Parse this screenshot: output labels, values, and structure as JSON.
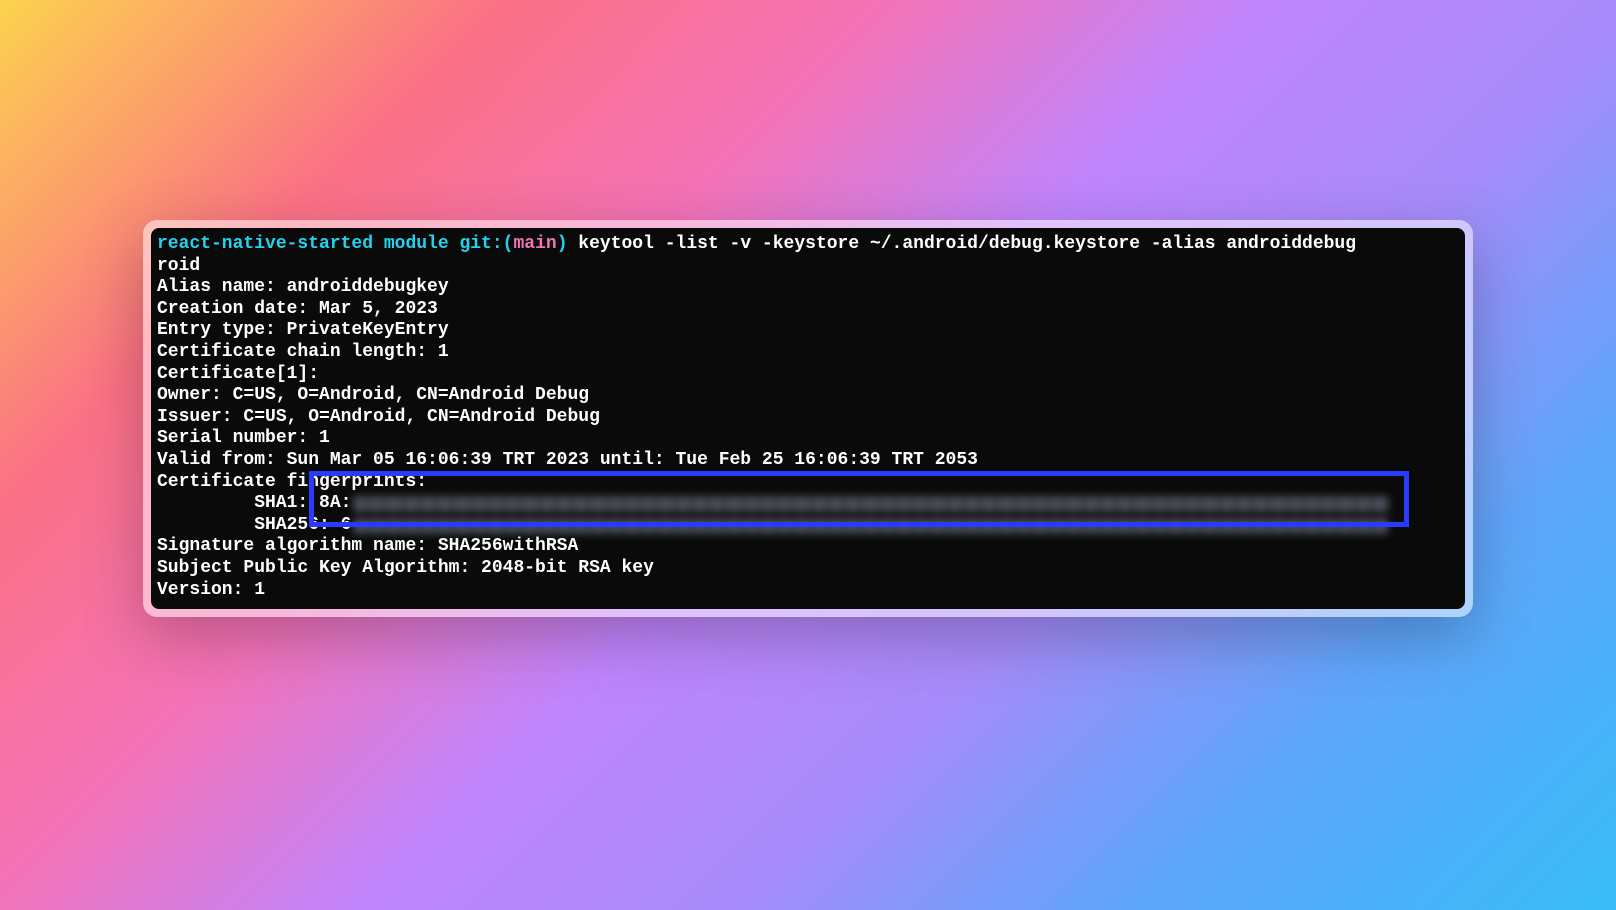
{
  "colors": {
    "highlight_border": "#2a3bff",
    "cyan": "#22d3ee",
    "pink": "#f472b6"
  },
  "top": {
    "cmd_frag1": " react-native-started module ",
    "git": "git:(",
    "branch": "main",
    "paren": ")",
    "cmd_frag2": "   keytool -list -v -keystore ~/.android/debug.keystore -alias androiddebug"
  },
  "lines": {
    "l0": "roid",
    "l1": "Alias name: androiddebugkey",
    "l2": "Creation date: Mar 5, 2023",
    "l3": "Entry type: PrivateKeyEntry",
    "l4": "Certificate chain length: 1",
    "l5": "Certificate[1]:",
    "l6": "Owner: C=US, O=Android, CN=Android Debug",
    "l7": "Issuer: C=US, O=Android, CN=Android Debug",
    "l8": "Serial number: 1",
    "l9": "Valid from: Sun Mar 05 16:06:39 TRT 2023 until: Tue Feb 25 16:06:39 TRT 2053",
    "l10": "Certificate fingerprints:",
    "sha1_label": "         SHA1: 8A:",
    "sha256_label": "         SHA256: 6",
    "l13": "Signature algorithm name: SHA256withRSA",
    "l14": "Subject Public Key Algorithm: 2048-bit RSA key",
    "l15": "Version: 1"
  }
}
